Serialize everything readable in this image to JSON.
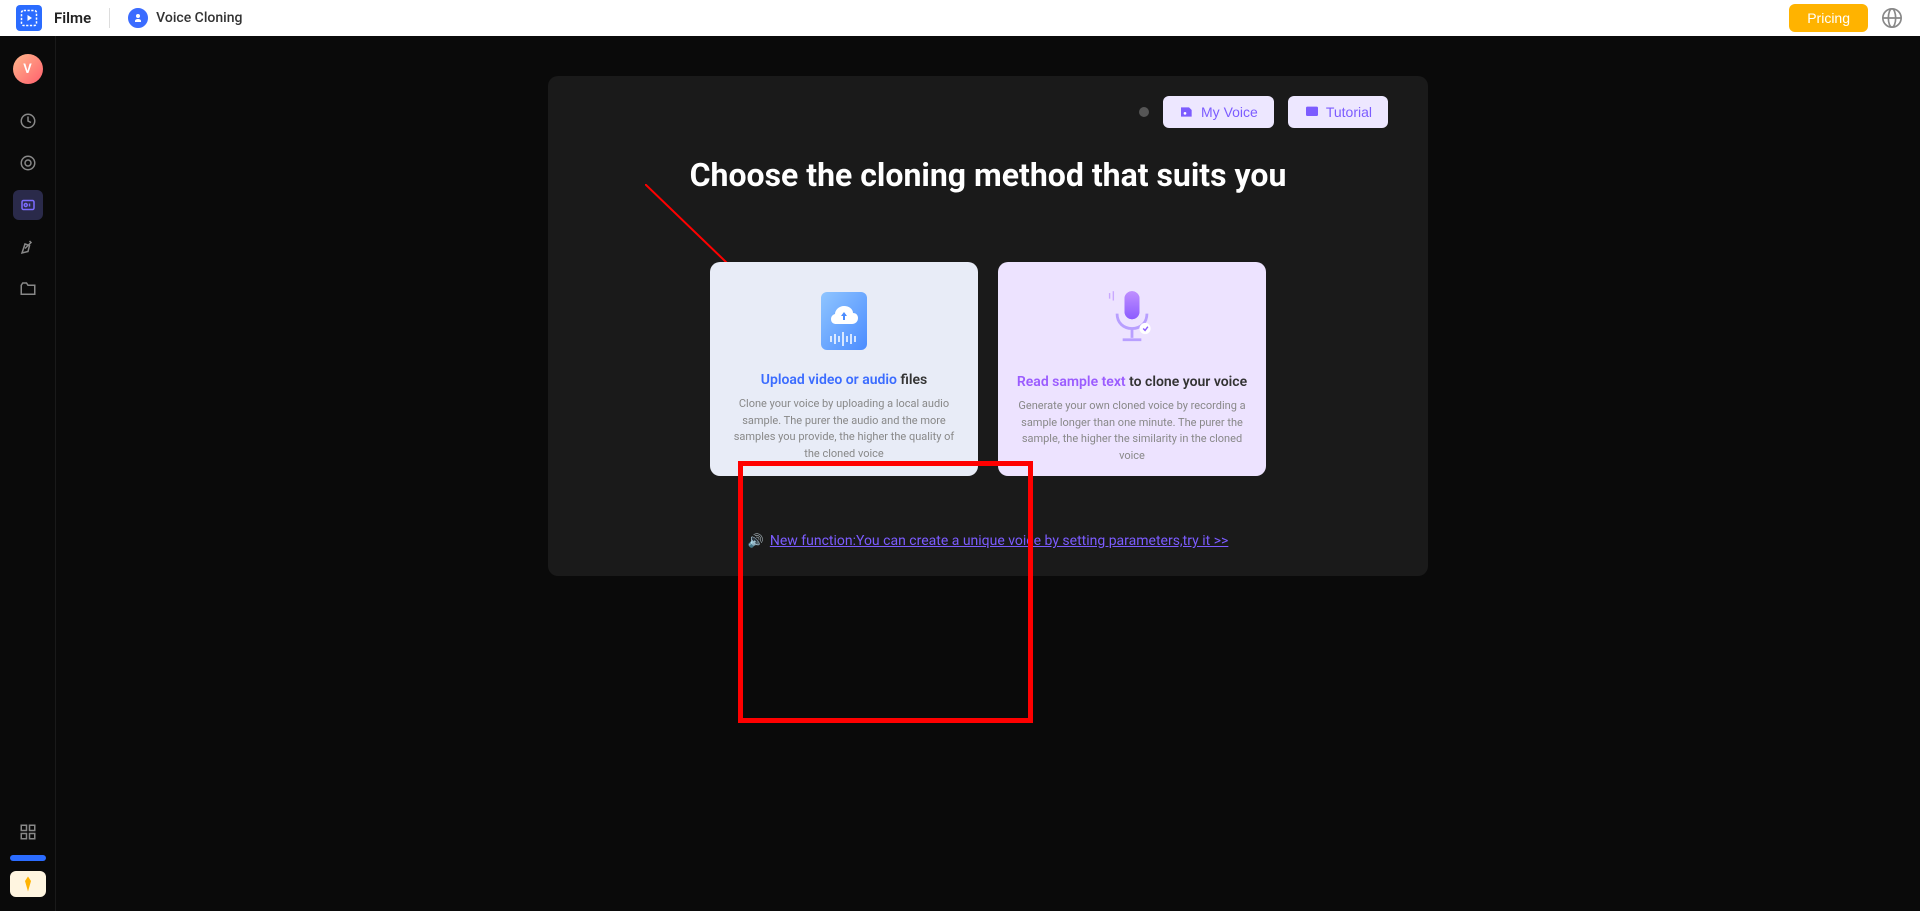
{
  "header": {
    "app_name": "Filme",
    "feature_name": "Voice Cloning",
    "pricing_label": "Pricing"
  },
  "sidebar": {
    "avatar_letter": "V"
  },
  "panel": {
    "my_voice_label": "My Voice",
    "tutorial_label": "Tutorial",
    "title": "Choose the cloning method that suits you",
    "card_upload": {
      "title_accent": "Upload video or audio",
      "title_rest": " files",
      "desc": "Clone your voice by uploading a local audio sample. The purer the audio and the more samples you provide, the higher the quality of the cloned voice"
    },
    "card_read": {
      "title_accent": "Read sample text",
      "title_rest": " to clone your voice",
      "desc": "Generate your own cloned voice by recording a sample longer than one minute. The purer the sample, the higher the similarity in the cloned voice"
    },
    "new_function_text": "New function:You can create a unique voice by setting parameters,try it >>"
  }
}
